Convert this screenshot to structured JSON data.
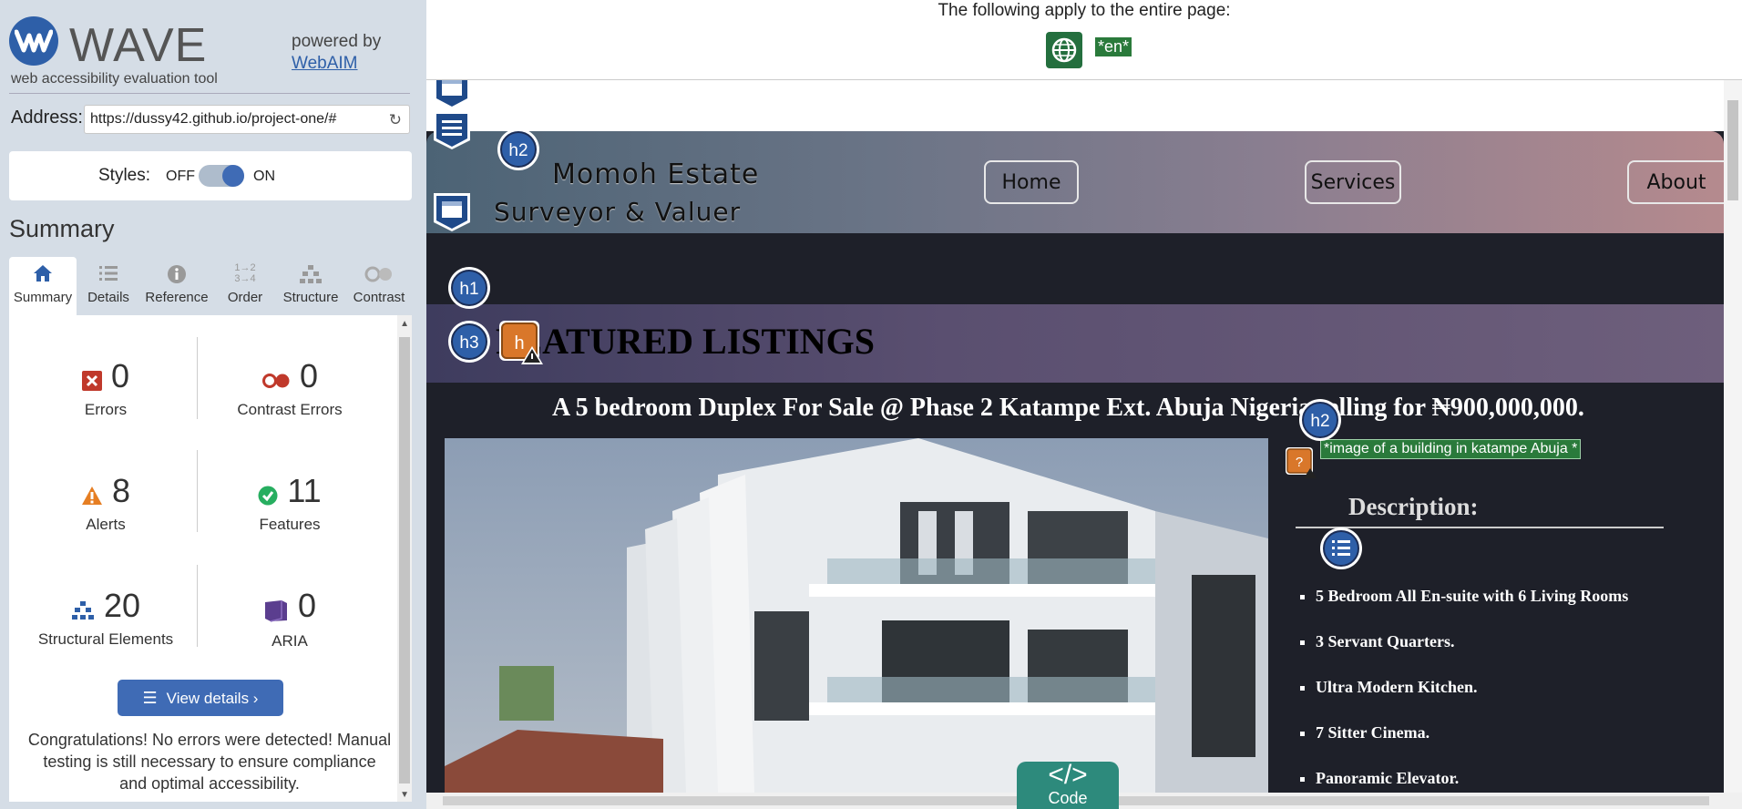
{
  "sidebar": {
    "logo_text": "WAVE",
    "logo_subtitle": "web accessibility evaluation tool",
    "powered_by": "powered by",
    "webaim_link": "WebAIM",
    "address_label": "Address:",
    "address_value": "https://dussy42.github.io/project-one/#",
    "styles_label": "Styles:",
    "styles_off": "OFF",
    "styles_on": "ON",
    "summary_heading": "Summary",
    "tabs": [
      {
        "label": "Summary",
        "icon": "home-icon"
      },
      {
        "label": "Details",
        "icon": "list-icon"
      },
      {
        "label": "Reference",
        "icon": "info-icon"
      },
      {
        "label": "Order",
        "icon": "order-icon"
      },
      {
        "label": "Structure",
        "icon": "structure-icon"
      },
      {
        "label": "Contrast",
        "icon": "contrast-icon"
      }
    ],
    "stats": [
      {
        "label": "Errors",
        "value": "0"
      },
      {
        "label": "Contrast Errors",
        "value": "0"
      },
      {
        "label": "Alerts",
        "value": "8"
      },
      {
        "label": "Features",
        "value": "11"
      },
      {
        "label": "Structural Elements",
        "value": "20"
      },
      {
        "label": "ARIA",
        "value": "0"
      }
    ],
    "view_details": "View details ›",
    "congrats": "Congratulations! No errors were detected! Manual testing is still necessary to ensure compliance and optimal accessibility."
  },
  "topbar": {
    "text": "The following apply to the entire page:",
    "lang": "*en*"
  },
  "page": {
    "brand_line1": "Momoh Estate",
    "brand_line2": "Surveyor & Valuer",
    "nav": [
      "Home",
      "Services",
      "About"
    ],
    "featured_title": "FEATURED LISTINGS",
    "listing_title": "A 5 bedroom Duplex For Sale @ Phase 2 Katampe Ext. Abuja Nigeria selling for ₦900,000,000.",
    "alt_text": "*image of a building in katampe Abuja *",
    "description_title": "Description:",
    "bullets": [
      "5 Bedroom All En-suite with 6 Living Rooms",
      "3 Servant Quarters.",
      "Ultra Modern Kitchen.",
      "7 Sitter Cinema.",
      "Panoramic Elevator."
    ],
    "badges": {
      "h1": "h1",
      "h2": "h2",
      "h3": "h3"
    },
    "code_button": "Code"
  },
  "colors": {
    "wave_blue": "#2e5fa8",
    "sidebar_bg": "#d5dde6",
    "error_red": "#c0392b",
    "alert_orange": "#e67e22",
    "feature_green": "#27ae60",
    "aria_purple": "#5b3e8f",
    "lang_green": "#2a7a3b"
  }
}
